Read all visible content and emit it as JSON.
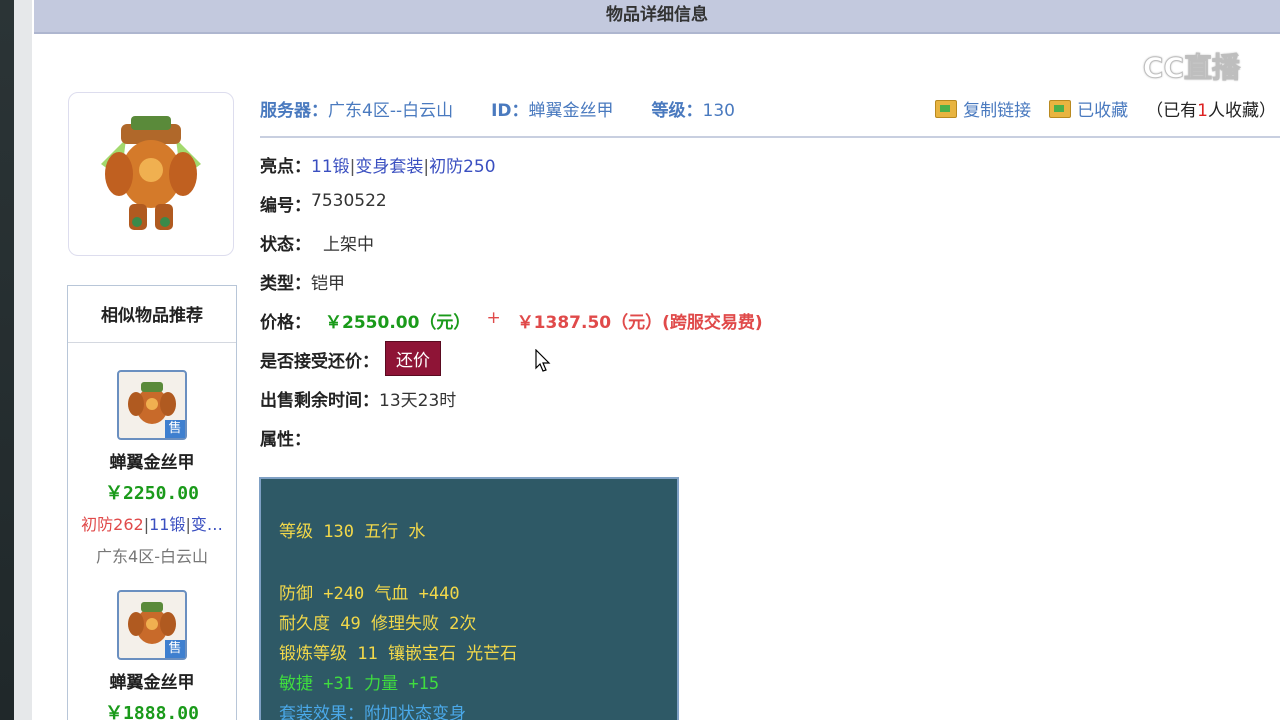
{
  "window": {
    "title": "物品详细信息"
  },
  "watermark": {
    "text": "CC直播"
  },
  "item": {
    "server_label": "服务器：",
    "server_value": "广东4区--白云山",
    "id_label": "ID：",
    "id_value": "蝉翼金丝甲",
    "level_label": "等级：",
    "level_value": "130",
    "copy_link": "复制链接",
    "favorited": "已收藏",
    "fav_prefix": "（已有",
    "fav_count": "1",
    "fav_suffix": "人收藏）",
    "highlights_label": "亮点：",
    "highlights": [
      "11锻",
      "变身套装",
      "初防250"
    ],
    "number_label": "编号：",
    "number_value": "7530522",
    "status_label": "状态：",
    "status_value": "上架中",
    "type_label": "类型：",
    "type_value": "铠甲",
    "price_label": "价格：",
    "price_value": "￥2550.00（元）",
    "plus": "+",
    "fee_value": "￥1387.50（元）(跨服交易费)",
    "bargain_label": "是否接受还价：",
    "bargain_button": "还价",
    "remaining_label": "出售剩余时间：",
    "remaining_value": "13天23时",
    "attributes_label": "属性："
  },
  "attributes": {
    "line1": "等级 130 五行 水",
    "line2": "防御 +240 气血 +440",
    "line3": "耐久度 49 修理失败 2次",
    "line4": "锻炼等级 11 镶嵌宝石 光芒石",
    "line5": "敏捷 +31 力量 +15",
    "line6": "套装效果：附加状态变身"
  },
  "similar": {
    "title": "相似物品推荐",
    "sell_badge": "售",
    "items": [
      {
        "name": "蝉翼金丝甲",
        "price": "￥2250.00",
        "tag1": "初防262",
        "tag2": "11锻",
        "tag3": "变…",
        "server": "广东4区-白云山"
      },
      {
        "name": "蝉翼金丝甲",
        "price": "￥1888.00"
      }
    ]
  },
  "colors": {
    "accent": "#4a7abf",
    "price": "#1a9a1a",
    "fee": "#e04a4a",
    "attr_bg": "#2e5966",
    "bargain": "#8e1436"
  }
}
